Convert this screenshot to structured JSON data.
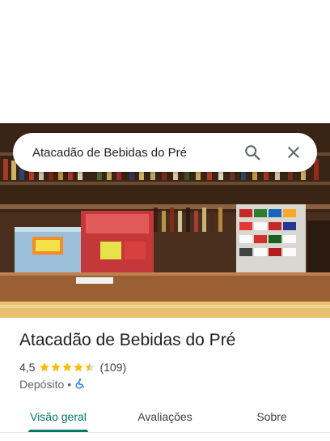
{
  "search": {
    "query": "Atacadão de Bebidas do Pré",
    "search_icon": "search-icon",
    "close_icon": "close-icon"
  },
  "place": {
    "name": "Atacadão de Bebidas do Pré",
    "rating": "4,5",
    "rating_value": 4.5,
    "review_count": "(109)",
    "category": "Depósito",
    "separator": "•",
    "accessibility_icon": "wheelchair-icon"
  },
  "tabs": [
    {
      "label": "Visão geral",
      "active": true
    },
    {
      "label": "Avaliações",
      "active": false
    },
    {
      "label": "Sobre",
      "active": false
    }
  ],
  "colors": {
    "accent": "#00796b",
    "star": "#fbbc04",
    "accessibility": "#1a73e8"
  }
}
